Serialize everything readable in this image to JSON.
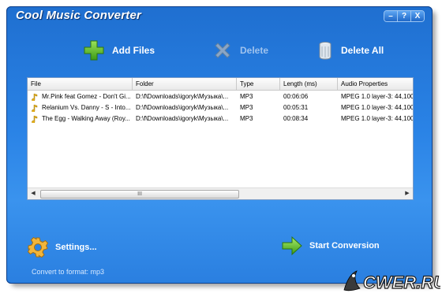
{
  "window": {
    "title": "Cool Music Converter",
    "controls": {
      "minimize": "–",
      "help": "?",
      "close": "X"
    }
  },
  "toolbar": {
    "add_files": "Add Files",
    "delete": "Delete",
    "delete_all": "Delete All"
  },
  "file_list": {
    "columns": [
      "File",
      "Folder",
      "Type",
      "Length (ms)",
      "Audio Properties"
    ],
    "rows": [
      {
        "file": "Mr.Pink feat Gomez - Don't Gi...",
        "folder": "D:\\f\\Downloads\\igoryk\\Музыка\\...",
        "type": "MP3",
        "length": "00:06:06",
        "audio": "MPEG 1.0 layer-3: 44,100"
      },
      {
        "file": "Relanium Vs. Danny - S - Into...",
        "folder": "D:\\f\\Downloads\\igoryk\\Музыка\\...",
        "type": "MP3",
        "length": "00:05:31",
        "audio": "MPEG 1.0 layer-3: 44,100"
      },
      {
        "file": "The Egg - Walking Away (Roy...",
        "folder": "D:\\f\\Downloads\\igoryk\\Музыка\\...",
        "type": "MP3",
        "length": "00:08:34",
        "audio": "MPEG 1.0 layer-3: 44,100"
      }
    ],
    "scrollbar_grip": "III"
  },
  "bottom": {
    "settings": "Settings...",
    "start": "Start Conversion",
    "status": "Convert to format: mp3"
  },
  "watermark": "CWER.RU",
  "icons": {
    "add": "plus-icon",
    "delete": "x-icon",
    "delete_all": "trash-icon",
    "file": "music-note-icon",
    "settings": "gear-icon",
    "start": "arrow-right-icon"
  },
  "colors": {
    "window_bg": "#2a83e6",
    "add_green": "#5fbf2a",
    "note_yellow": "#e7b21c"
  }
}
